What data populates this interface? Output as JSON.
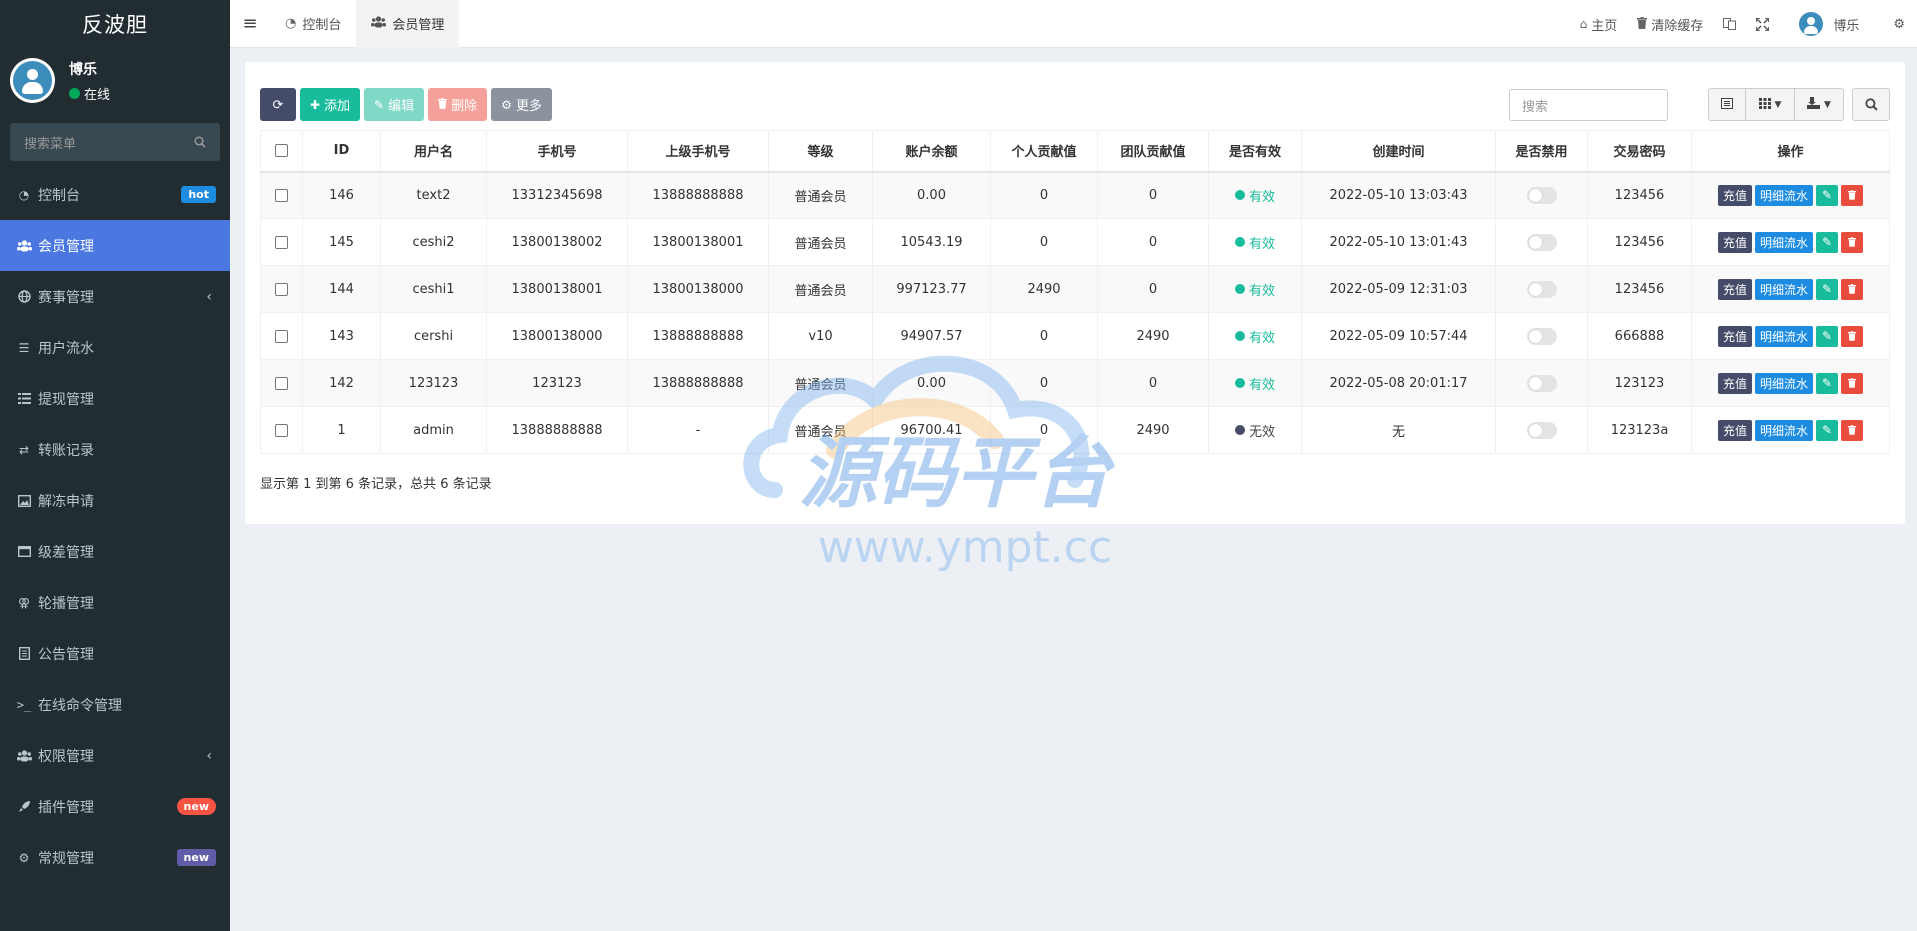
{
  "brand": {
    "title": "反波胆"
  },
  "user": {
    "name": "博乐",
    "status": "在线"
  },
  "sidebar": {
    "search_placeholder": "搜索菜单",
    "items": [
      {
        "label": "控制台",
        "icon": "dashboard-icon",
        "badge": "hot"
      },
      {
        "label": "会员管理",
        "icon": "users-icon",
        "active": true
      },
      {
        "label": "赛事管理",
        "icon": "globe-icon",
        "expandable": true
      },
      {
        "label": "用户流水",
        "icon": "list-icon"
      },
      {
        "label": "提现管理",
        "icon": "list-alt-icon"
      },
      {
        "label": "转账记录",
        "icon": "transfer-icon"
      },
      {
        "label": "解冻申请",
        "icon": "picture-icon"
      },
      {
        "label": "级差管理",
        "icon": "window-icon"
      },
      {
        "label": "轮播管理",
        "icon": "venus-mars-icon"
      },
      {
        "label": "公告管理",
        "icon": "file-icon"
      },
      {
        "label": "在线命令管理",
        "icon": "terminal-icon"
      },
      {
        "label": "权限管理",
        "icon": "group-icon",
        "expandable": true
      },
      {
        "label": "插件管理",
        "icon": "rocket-icon",
        "badge": "new"
      },
      {
        "label": "常规管理",
        "icon": "cogs-icon",
        "badge": "new"
      }
    ]
  },
  "header": {
    "tabs": [
      {
        "label": "控制台",
        "icon": "dashboard-icon"
      },
      {
        "label": "会员管理",
        "icon": "users-icon",
        "active": true
      }
    ],
    "links": {
      "home": "主页",
      "clear_cache": "清除缓存"
    },
    "user_name": "博乐"
  },
  "toolbar": {
    "add_label": "添加",
    "edit_label": "编辑",
    "delete_label": "删除",
    "more_label": "更多",
    "search_placeholder": "搜索"
  },
  "table": {
    "columns": [
      "ID",
      "用户名",
      "手机号",
      "上级手机号",
      "等级",
      "账户余额",
      "个人贡献值",
      "团队贡献值",
      "是否有效",
      "创建时间",
      "是否禁用",
      "交易密码",
      "操作"
    ],
    "rows": [
      {
        "id": "146",
        "username": "text2",
        "phone": "13312345698",
        "parent_phone": "13888888888",
        "level": "普通会员",
        "balance": "0.00",
        "personal": "0",
        "team": "0",
        "valid": "有效",
        "created": "2022-05-10 13:03:43",
        "pwd": "123456"
      },
      {
        "id": "145",
        "username": "ceshi2",
        "phone": "13800138002",
        "parent_phone": "13800138001",
        "level": "普通会员",
        "balance": "10543.19",
        "personal": "0",
        "team": "0",
        "valid": "有效",
        "created": "2022-05-10 13:01:43",
        "pwd": "123456"
      },
      {
        "id": "144",
        "username": "ceshi1",
        "phone": "13800138001",
        "parent_phone": "13800138000",
        "level": "普通会员",
        "balance": "997123.77",
        "personal": "2490",
        "team": "0",
        "valid": "有效",
        "created": "2022-05-09 12:31:03",
        "pwd": "123456"
      },
      {
        "id": "143",
        "username": "cershi",
        "phone": "13800138000",
        "parent_phone": "13888888888",
        "level": "v10",
        "balance": "94907.57",
        "personal": "0",
        "team": "2490",
        "valid": "有效",
        "created": "2022-05-09 10:57:44",
        "pwd": "666888"
      },
      {
        "id": "142",
        "username": "123123",
        "phone": "123123",
        "parent_phone": "13888888888",
        "level": "普通会员",
        "balance": "0.00",
        "personal": "0",
        "team": "0",
        "valid": "有效",
        "created": "2022-05-08 20:01:17",
        "pwd": "123123"
      },
      {
        "id": "1",
        "username": "admin",
        "phone": "13888888888",
        "parent_phone": "-",
        "level": "普通会员",
        "balance": "96700.41",
        "personal": "0",
        "team": "2490",
        "valid": "无效",
        "created": "无",
        "pwd": "123123a"
      }
    ],
    "ops": {
      "charge": "充值",
      "flow": "明细流水"
    }
  },
  "pager": {
    "summary": "显示第 1 到第 6 条记录，总共 6 条记录"
  },
  "watermark": {
    "text": "源码平台",
    "url": "www.ympt.cc"
  },
  "colors": {
    "sidebar_bg": "#222d32",
    "active": "#4a77e0",
    "success": "#18bc9c",
    "danger": "#e74c3c",
    "primary": "#1d8ce0",
    "dark": "#444c69"
  }
}
